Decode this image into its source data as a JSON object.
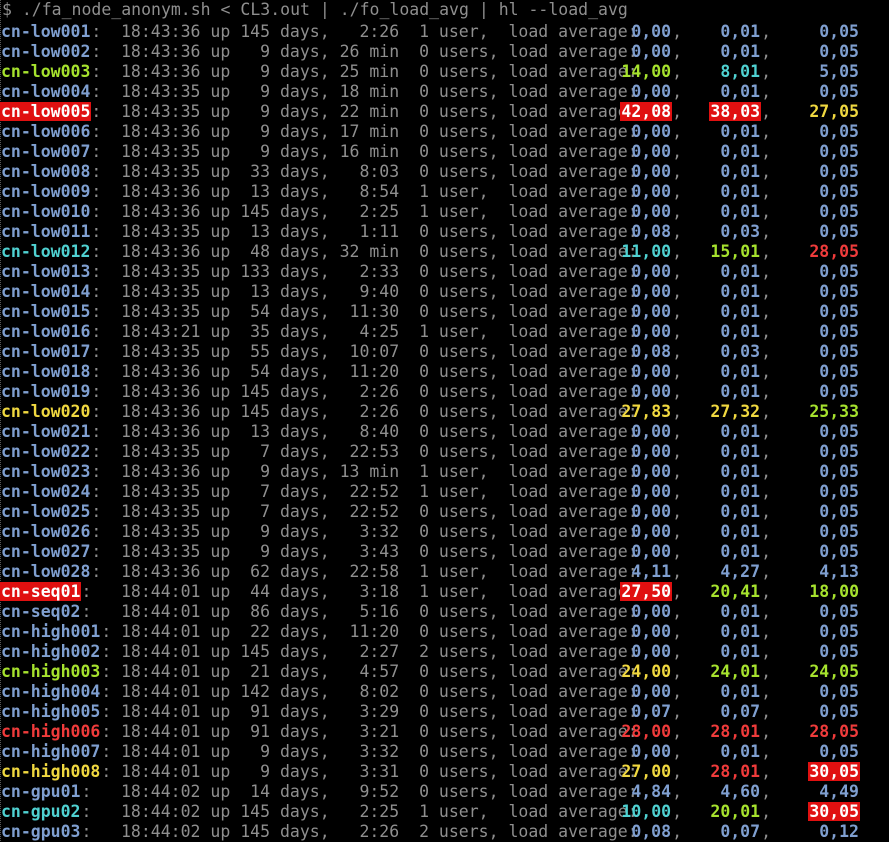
{
  "prompt": "$ ./fa_node_anonym.sh < CL3.out | ./fo_load_avg | hl --load_avg",
  "rows": [
    {
      "host": "cn-low001",
      "time": "18:43:36",
      "uptime": "145 days,   2:26",
      "users": "1 user, ",
      "loads": [
        "0,00",
        "0,01",
        "0,05"
      ],
      "host_color": "normal",
      "load_colors": [
        "normal",
        "normal",
        "normal"
      ]
    },
    {
      "host": "cn-low002",
      "time": "18:43:36",
      "uptime": "  9 days, 26 min",
      "users": "0 users,",
      "loads": [
        "0,00",
        "0,01",
        "0,05"
      ],
      "host_color": "normal",
      "load_colors": [
        "normal",
        "normal",
        "normal"
      ]
    },
    {
      "host": "cn-low003",
      "time": "18:43:36",
      "uptime": "  9 days, 25 min",
      "users": "0 users,",
      "loads": [
        "14,00",
        "8,01",
        "5,05"
      ],
      "host_color": "green",
      "load_colors": [
        "green",
        "cyan",
        "normal"
      ]
    },
    {
      "host": "cn-low004",
      "time": "18:43:35",
      "uptime": "  9 days, 18 min",
      "users": "0 users,",
      "loads": [
        "0,00",
        "0,01",
        "0,05"
      ],
      "host_color": "normal",
      "load_colors": [
        "normal",
        "normal",
        "normal"
      ]
    },
    {
      "host": "cn-low005",
      "time": "18:43:35",
      "uptime": "  9 days, 22 min",
      "users": "0 users,",
      "loads": [
        "42,08",
        "38,03",
        "27,05"
      ],
      "host_color": "alert",
      "load_colors": [
        "alert",
        "alert",
        "yellow"
      ]
    },
    {
      "host": "cn-low006",
      "time": "18:43:36",
      "uptime": "  9 days, 17 min",
      "users": "0 users,",
      "loads": [
        "0,00",
        "0,01",
        "0,05"
      ],
      "host_color": "normal",
      "load_colors": [
        "normal",
        "normal",
        "normal"
      ]
    },
    {
      "host": "cn-low007",
      "time": "18:43:35",
      "uptime": "  9 days, 16 min",
      "users": "0 users,",
      "loads": [
        "0,00",
        "0,01",
        "0,05"
      ],
      "host_color": "normal",
      "load_colors": [
        "normal",
        "normal",
        "normal"
      ]
    },
    {
      "host": "cn-low008",
      "time": "18:43:35",
      "uptime": " 33 days,   8:03",
      "users": "0 users,",
      "loads": [
        "0,00",
        "0,01",
        "0,05"
      ],
      "host_color": "normal",
      "load_colors": [
        "normal",
        "normal",
        "normal"
      ]
    },
    {
      "host": "cn-low009",
      "time": "18:43:36",
      "uptime": " 13 days,   8:54",
      "users": "1 user, ",
      "loads": [
        "0,00",
        "0,01",
        "0,05"
      ],
      "host_color": "normal",
      "load_colors": [
        "normal",
        "normal",
        "normal"
      ]
    },
    {
      "host": "cn-low010",
      "time": "18:43:36",
      "uptime": "145 days,   2:25",
      "users": "1 user, ",
      "loads": [
        "0,00",
        "0,01",
        "0,05"
      ],
      "host_color": "normal",
      "load_colors": [
        "normal",
        "normal",
        "normal"
      ]
    },
    {
      "host": "cn-low011",
      "time": "18:43:35",
      "uptime": " 13 days,   1:11",
      "users": "0 users,",
      "loads": [
        "0,08",
        "0,03",
        "0,05"
      ],
      "host_color": "normal",
      "load_colors": [
        "normal",
        "normal",
        "normal"
      ]
    },
    {
      "host": "cn-low012",
      "time": "18:43:36",
      "uptime": " 48 days, 32 min",
      "users": "0 users,",
      "loads": [
        "11,00",
        "15,01",
        "28,05"
      ],
      "host_color": "cyan",
      "load_colors": [
        "cyan",
        "green",
        "red"
      ]
    },
    {
      "host": "cn-low013",
      "time": "18:43:35",
      "uptime": "133 days,   2:33",
      "users": "0 users,",
      "loads": [
        "0,00",
        "0,01",
        "0,05"
      ],
      "host_color": "normal",
      "load_colors": [
        "normal",
        "normal",
        "normal"
      ]
    },
    {
      "host": "cn-low014",
      "time": "18:43:35",
      "uptime": " 13 days,   9:40",
      "users": "0 users,",
      "loads": [
        "0,00",
        "0,01",
        "0,05"
      ],
      "host_color": "normal",
      "load_colors": [
        "normal",
        "normal",
        "normal"
      ]
    },
    {
      "host": "cn-low015",
      "time": "18:43:35",
      "uptime": " 54 days,  11:30",
      "users": "0 users,",
      "loads": [
        "0,00",
        "0,01",
        "0,05"
      ],
      "host_color": "normal",
      "load_colors": [
        "normal",
        "normal",
        "normal"
      ]
    },
    {
      "host": "cn-low016",
      "time": "18:43:21",
      "uptime": " 35 days,   4:25",
      "users": "1 user, ",
      "loads": [
        "0,00",
        "0,01",
        "0,05"
      ],
      "host_color": "normal",
      "load_colors": [
        "normal",
        "normal",
        "normal"
      ]
    },
    {
      "host": "cn-low017",
      "time": "18:43:35",
      "uptime": " 55 days,  10:07",
      "users": "0 users,",
      "loads": [
        "0,08",
        "0,03",
        "0,05"
      ],
      "host_color": "normal",
      "load_colors": [
        "normal",
        "normal",
        "normal"
      ]
    },
    {
      "host": "cn-low018",
      "time": "18:43:36",
      "uptime": " 54 days,  11:20",
      "users": "0 users,",
      "loads": [
        "0,00",
        "0,01",
        "0,05"
      ],
      "host_color": "normal",
      "load_colors": [
        "normal",
        "normal",
        "normal"
      ]
    },
    {
      "host": "cn-low019",
      "time": "18:43:36",
      "uptime": "145 days,   2:26",
      "users": "0 users,",
      "loads": [
        "0,00",
        "0,01",
        "0,05"
      ],
      "host_color": "normal",
      "load_colors": [
        "normal",
        "normal",
        "normal"
      ]
    },
    {
      "host": "cn-low020",
      "time": "18:43:36",
      "uptime": "145 days,   2:26",
      "users": "0 users,",
      "loads": [
        "27,83",
        "27,32",
        "25,33"
      ],
      "host_color": "yellow",
      "load_colors": [
        "yellow",
        "yellow",
        "green"
      ]
    },
    {
      "host": "cn-low021",
      "time": "18:43:36",
      "uptime": " 13 days,   8:40",
      "users": "0 users,",
      "loads": [
        "0,00",
        "0,01",
        "0,05"
      ],
      "host_color": "normal",
      "load_colors": [
        "normal",
        "normal",
        "normal"
      ]
    },
    {
      "host": "cn-low022",
      "time": "18:43:35",
      "uptime": "  7 days,  22:53",
      "users": "0 users,",
      "loads": [
        "0,00",
        "0,01",
        "0,05"
      ],
      "host_color": "normal",
      "load_colors": [
        "normal",
        "normal",
        "normal"
      ]
    },
    {
      "host": "cn-low023",
      "time": "18:43:36",
      "uptime": "  9 days, 13 min",
      "users": "1 user, ",
      "loads": [
        "0,00",
        "0,01",
        "0,05"
      ],
      "host_color": "normal",
      "load_colors": [
        "normal",
        "normal",
        "normal"
      ]
    },
    {
      "host": "cn-low024",
      "time": "18:43:35",
      "uptime": "  7 days,  22:52",
      "users": "1 user, ",
      "loads": [
        "0,00",
        "0,01",
        "0,05"
      ],
      "host_color": "normal",
      "load_colors": [
        "normal",
        "normal",
        "normal"
      ]
    },
    {
      "host": "cn-low025",
      "time": "18:43:35",
      "uptime": "  7 days,  22:52",
      "users": "0 users,",
      "loads": [
        "0,00",
        "0,01",
        "0,05"
      ],
      "host_color": "normal",
      "load_colors": [
        "normal",
        "normal",
        "normal"
      ]
    },
    {
      "host": "cn-low026",
      "time": "18:43:35",
      "uptime": "  9 days,   3:32",
      "users": "0 users,",
      "loads": [
        "0,00",
        "0,01",
        "0,05"
      ],
      "host_color": "normal",
      "load_colors": [
        "normal",
        "normal",
        "normal"
      ]
    },
    {
      "host": "cn-low027",
      "time": "18:43:35",
      "uptime": "  9 days,   3:43",
      "users": "0 users,",
      "loads": [
        "0,00",
        "0,01",
        "0,05"
      ],
      "host_color": "normal",
      "load_colors": [
        "normal",
        "normal",
        "normal"
      ]
    },
    {
      "host": "cn-low028",
      "time": "18:43:36",
      "uptime": " 62 days,  22:58",
      "users": "1 user, ",
      "loads": [
        "4,11",
        "4,27",
        "4,13"
      ],
      "host_color": "normal",
      "load_colors": [
        "normal",
        "normal",
        "normal"
      ]
    },
    {
      "host": "cn-seq01",
      "time": "18:44:01",
      "uptime": " 44 days,   3:18",
      "users": "1 user, ",
      "loads": [
        "27,50",
        "20,41",
        "18,00"
      ],
      "host_color": "alert",
      "load_colors": [
        "alert",
        "green",
        "green"
      ]
    },
    {
      "host": "cn-seq02",
      "time": "18:44:01",
      "uptime": " 86 days,   5:16",
      "users": "0 users,",
      "loads": [
        "0,00",
        "0,01",
        "0,05"
      ],
      "host_color": "normal",
      "load_colors": [
        "normal",
        "normal",
        "normal"
      ]
    },
    {
      "host": "cn-high001",
      "time": "18:44:01",
      "uptime": " 22 days,  11:20",
      "users": "0 users,",
      "loads": [
        "0,00",
        "0,01",
        "0,05"
      ],
      "host_color": "normal",
      "load_colors": [
        "normal",
        "normal",
        "normal"
      ]
    },
    {
      "host": "cn-high002",
      "time": "18:44:01",
      "uptime": "145 days,   2:27",
      "users": "2 users,",
      "loads": [
        "0,00",
        "0,01",
        "0,05"
      ],
      "host_color": "normal",
      "load_colors": [
        "normal",
        "normal",
        "normal"
      ]
    },
    {
      "host": "cn-high003",
      "time": "18:44:01",
      "uptime": " 21 days,   4:57",
      "users": "0 users,",
      "loads": [
        "24,00",
        "24,01",
        "24,05"
      ],
      "host_color": "green",
      "load_colors": [
        "yellow",
        "green",
        "green"
      ]
    },
    {
      "host": "cn-high004",
      "time": "18:44:01",
      "uptime": "142 days,   8:02",
      "users": "0 users,",
      "loads": [
        "0,00",
        "0,01",
        "0,05"
      ],
      "host_color": "normal",
      "load_colors": [
        "normal",
        "normal",
        "normal"
      ]
    },
    {
      "host": "cn-high005",
      "time": "18:44:01",
      "uptime": " 91 days,   3:29",
      "users": "0 users,",
      "loads": [
        "0,07",
        "0,07",
        "0,05"
      ],
      "host_color": "normal",
      "load_colors": [
        "normal",
        "normal",
        "normal"
      ]
    },
    {
      "host": "cn-high006",
      "time": "18:44:01",
      "uptime": " 91 days,   3:21",
      "users": "0 users,",
      "loads": [
        "28,00",
        "28,01",
        "28,05"
      ],
      "host_color": "red",
      "load_colors": [
        "red",
        "red",
        "red"
      ]
    },
    {
      "host": "cn-high007",
      "time": "18:44:01",
      "uptime": "  9 days,   3:32",
      "users": "0 users,",
      "loads": [
        "0,00",
        "0,01",
        "0,05"
      ],
      "host_color": "normal",
      "load_colors": [
        "normal",
        "normal",
        "normal"
      ]
    },
    {
      "host": "cn-high008",
      "time": "18:44:01",
      "uptime": "  9 days,   3:31",
      "users": "0 users,",
      "loads": [
        "27,00",
        "28,01",
        "30,05"
      ],
      "host_color": "yellow",
      "load_colors": [
        "yellow",
        "red",
        "alert"
      ]
    },
    {
      "host": "cn-gpu01",
      "time": "18:44:02",
      "uptime": " 14 days,   9:52",
      "users": "0 users,",
      "loads": [
        "4,84",
        "4,60",
        "4,49"
      ],
      "host_color": "normal",
      "load_colors": [
        "normal",
        "normal",
        "normal"
      ]
    },
    {
      "host": "cn-gpu02",
      "time": "18:44:02",
      "uptime": "145 days,   2:25",
      "users": "1 user, ",
      "loads": [
        "10,00",
        "20,01",
        "30,05"
      ],
      "host_color": "cyan",
      "load_colors": [
        "cyan",
        "green",
        "alert"
      ]
    },
    {
      "host": "cn-gpu03",
      "time": "18:44:02",
      "uptime": "145 days,   2:26",
      "users": "2 users,",
      "loads": [
        "0,08",
        "0,07",
        "0,12"
      ],
      "host_color": "normal",
      "load_colors": [
        "normal",
        "normal",
        "normal"
      ]
    }
  ],
  "labels": {
    "up": "up",
    "load_average": "load average:"
  },
  "colors": {
    "normal": "#7f9fd0",
    "green": "#a6e22e",
    "cyan": "#4fd1d1",
    "yellow": "#f0d840",
    "red": "#ef3b3b",
    "alert_bg": "#e01010",
    "text": "#8f8f8f",
    "background": "#000000"
  }
}
